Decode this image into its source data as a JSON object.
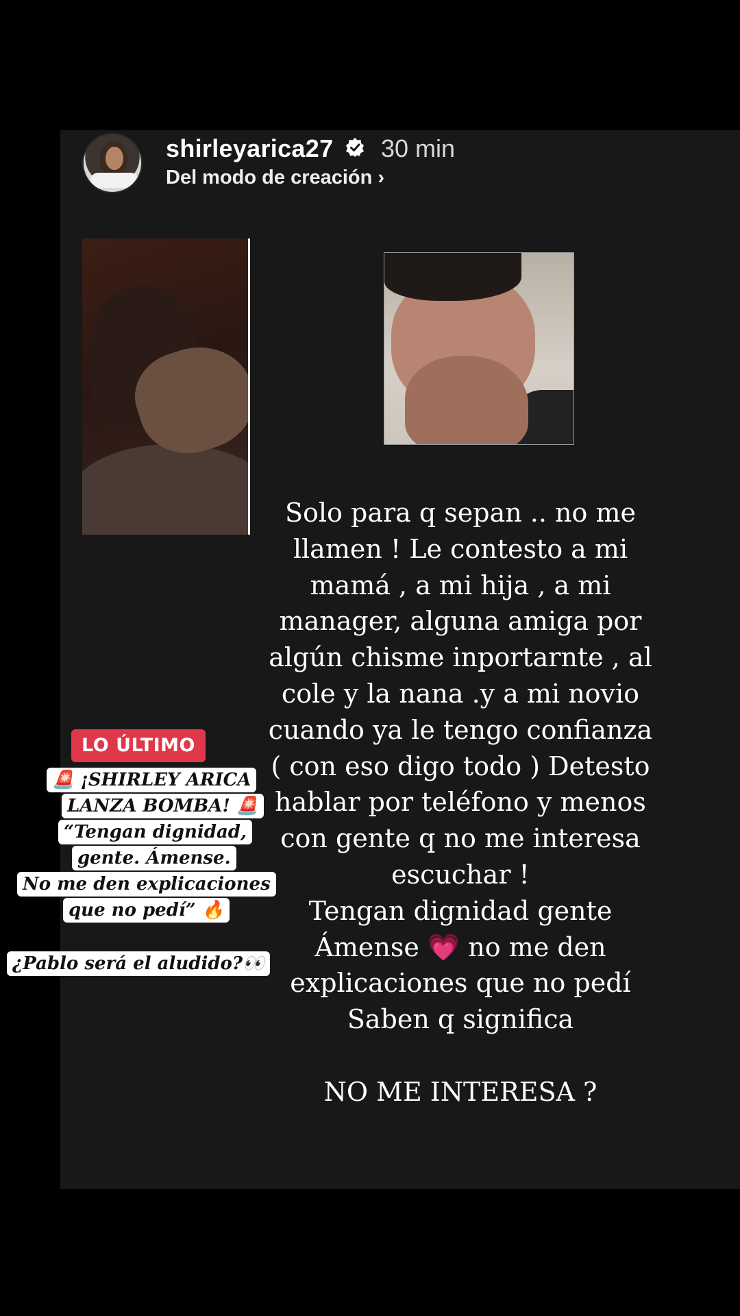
{
  "header": {
    "username": "shirleyarica27",
    "time": "30 min",
    "subline": "Del modo de creación ›"
  },
  "icons": {
    "verified": "verified-badge-icon",
    "menu": "more-dot-icon",
    "siren": "🚨",
    "fire": "🔥",
    "eyes": "👀",
    "heart": "💗"
  },
  "story": {
    "text_part1": "Solo para q sepan .. no me\nllamen ! Le contesto a mi\nmamá , a mi hija , a mi\nmanager, alguna amiga por\nalgún chisme inportarnte , al\ncole y la nana .y a mi novio\ncuando ya le tengo confianza\n( con eso digo todo ) Detesto\nhablar por teléfono y menos\ncon gente q no me interesa\nescuchar !\nTengan dignidad gente\nÁmense ",
    "heart": "💗",
    "text_part2": " no me den\nexplicaciones que no pedí\nSaben q significa\n\nNO ME INTERESA ?"
  },
  "overlay": {
    "badge": "LO ÚLTIMO",
    "lines": [
      "🚨 ¡SHIRLEY ARICA",
      "LANZA BOMBA! 🚨",
      "“Tengan dignidad,",
      "gente. Ámense.",
      "No me den explicaciones",
      "que no pedí” 🔥",
      "¿Pablo será el aludido?👀"
    ]
  },
  "colors": {
    "background": "#000000",
    "story_bg": "#181818",
    "badge_red": "#e0374a",
    "heart_pink": "#ff3ea5"
  }
}
